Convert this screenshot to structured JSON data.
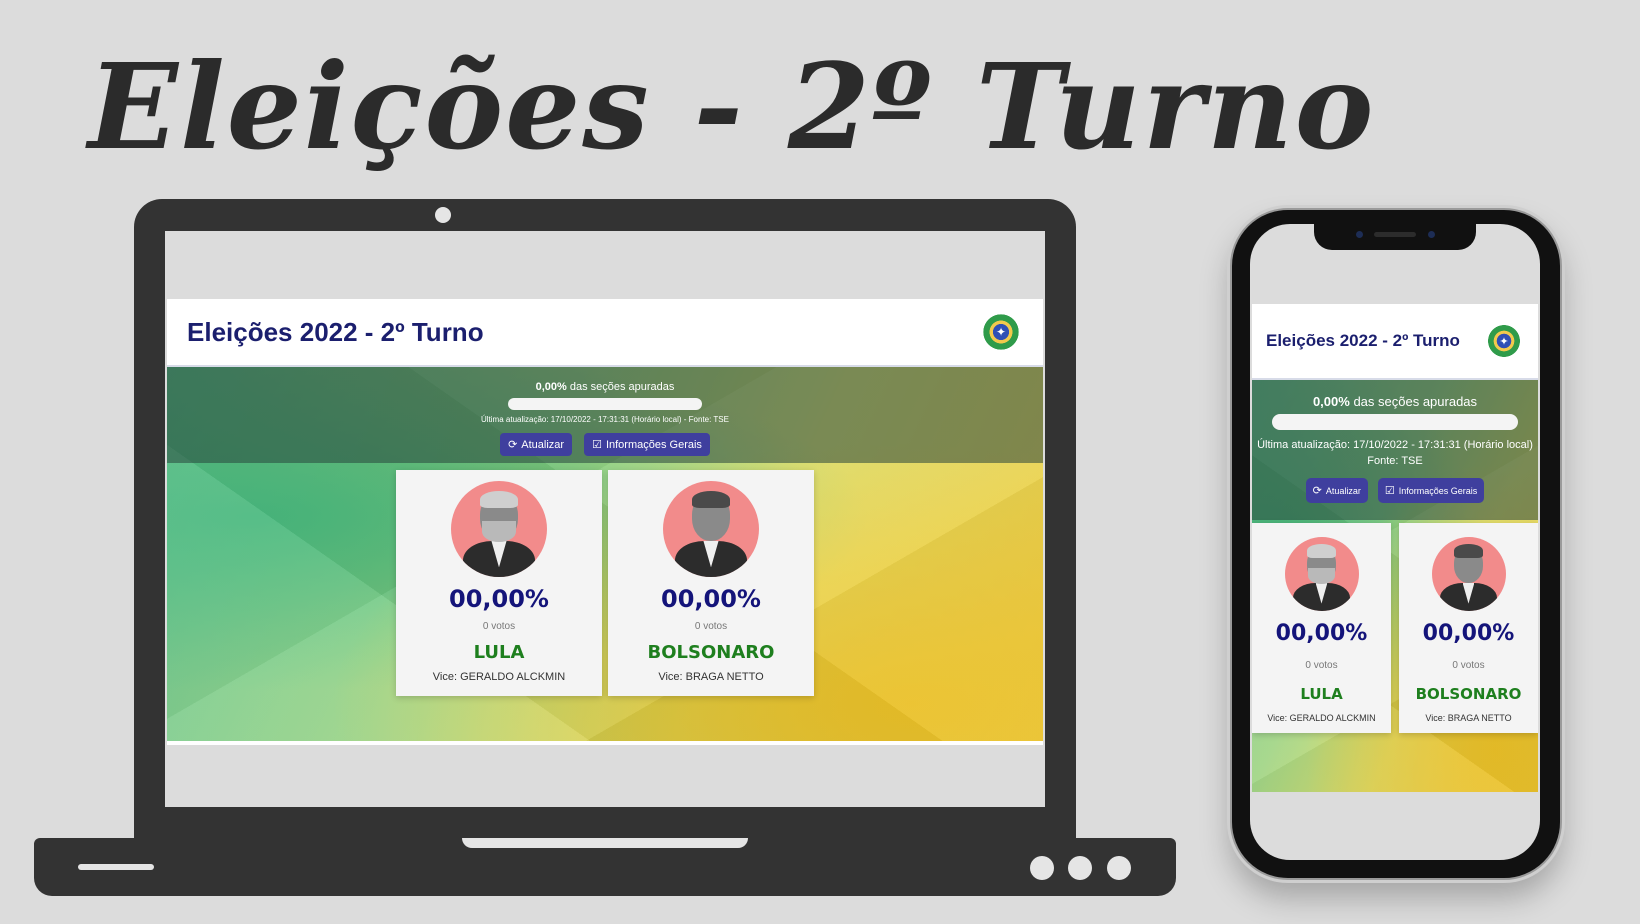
{
  "hero": {
    "title": "Eleições - 2º Turno"
  },
  "app": {
    "title": "Eleições 2022 - 2º Turno",
    "emblem_icon": "brazil-coat-of-arms-icon",
    "progress": {
      "percent_text": "0,00%",
      "suffix_text": " das seções apuradas",
      "fraction": 0
    },
    "update_text": "Última atualização: 17/10/2022 - 17:31:31 (Horário local) - Fonte: TSE",
    "update_line1": "Última atualização: 17/10/2022 - 17:31:31 (Horário local)",
    "update_line2": "Fonte: TSE",
    "buttons": {
      "refresh_label": "Atualizar",
      "refresh_icon": "refresh-icon",
      "info_label": "Informações Gerais",
      "info_icon": "info-box-icon"
    },
    "candidates": [
      {
        "name": "LULA",
        "percent": "00,00%",
        "votes": "0 votos",
        "vice": "Vice: GERALDO ALCKMIN",
        "photo": "lula-photo"
      },
      {
        "name": "BOLSONARO",
        "percent": "00,00%",
        "votes": "0 votos",
        "vice": "Vice: BRAGA NETTO",
        "photo": "bolsonaro-photo"
      }
    ]
  },
  "colors": {
    "title": "#1b1f6e",
    "percent": "#14147a",
    "candidate_name": "#1e7f1e",
    "button": "#3f3f9e",
    "avatar_bg": "#f28b8b"
  }
}
